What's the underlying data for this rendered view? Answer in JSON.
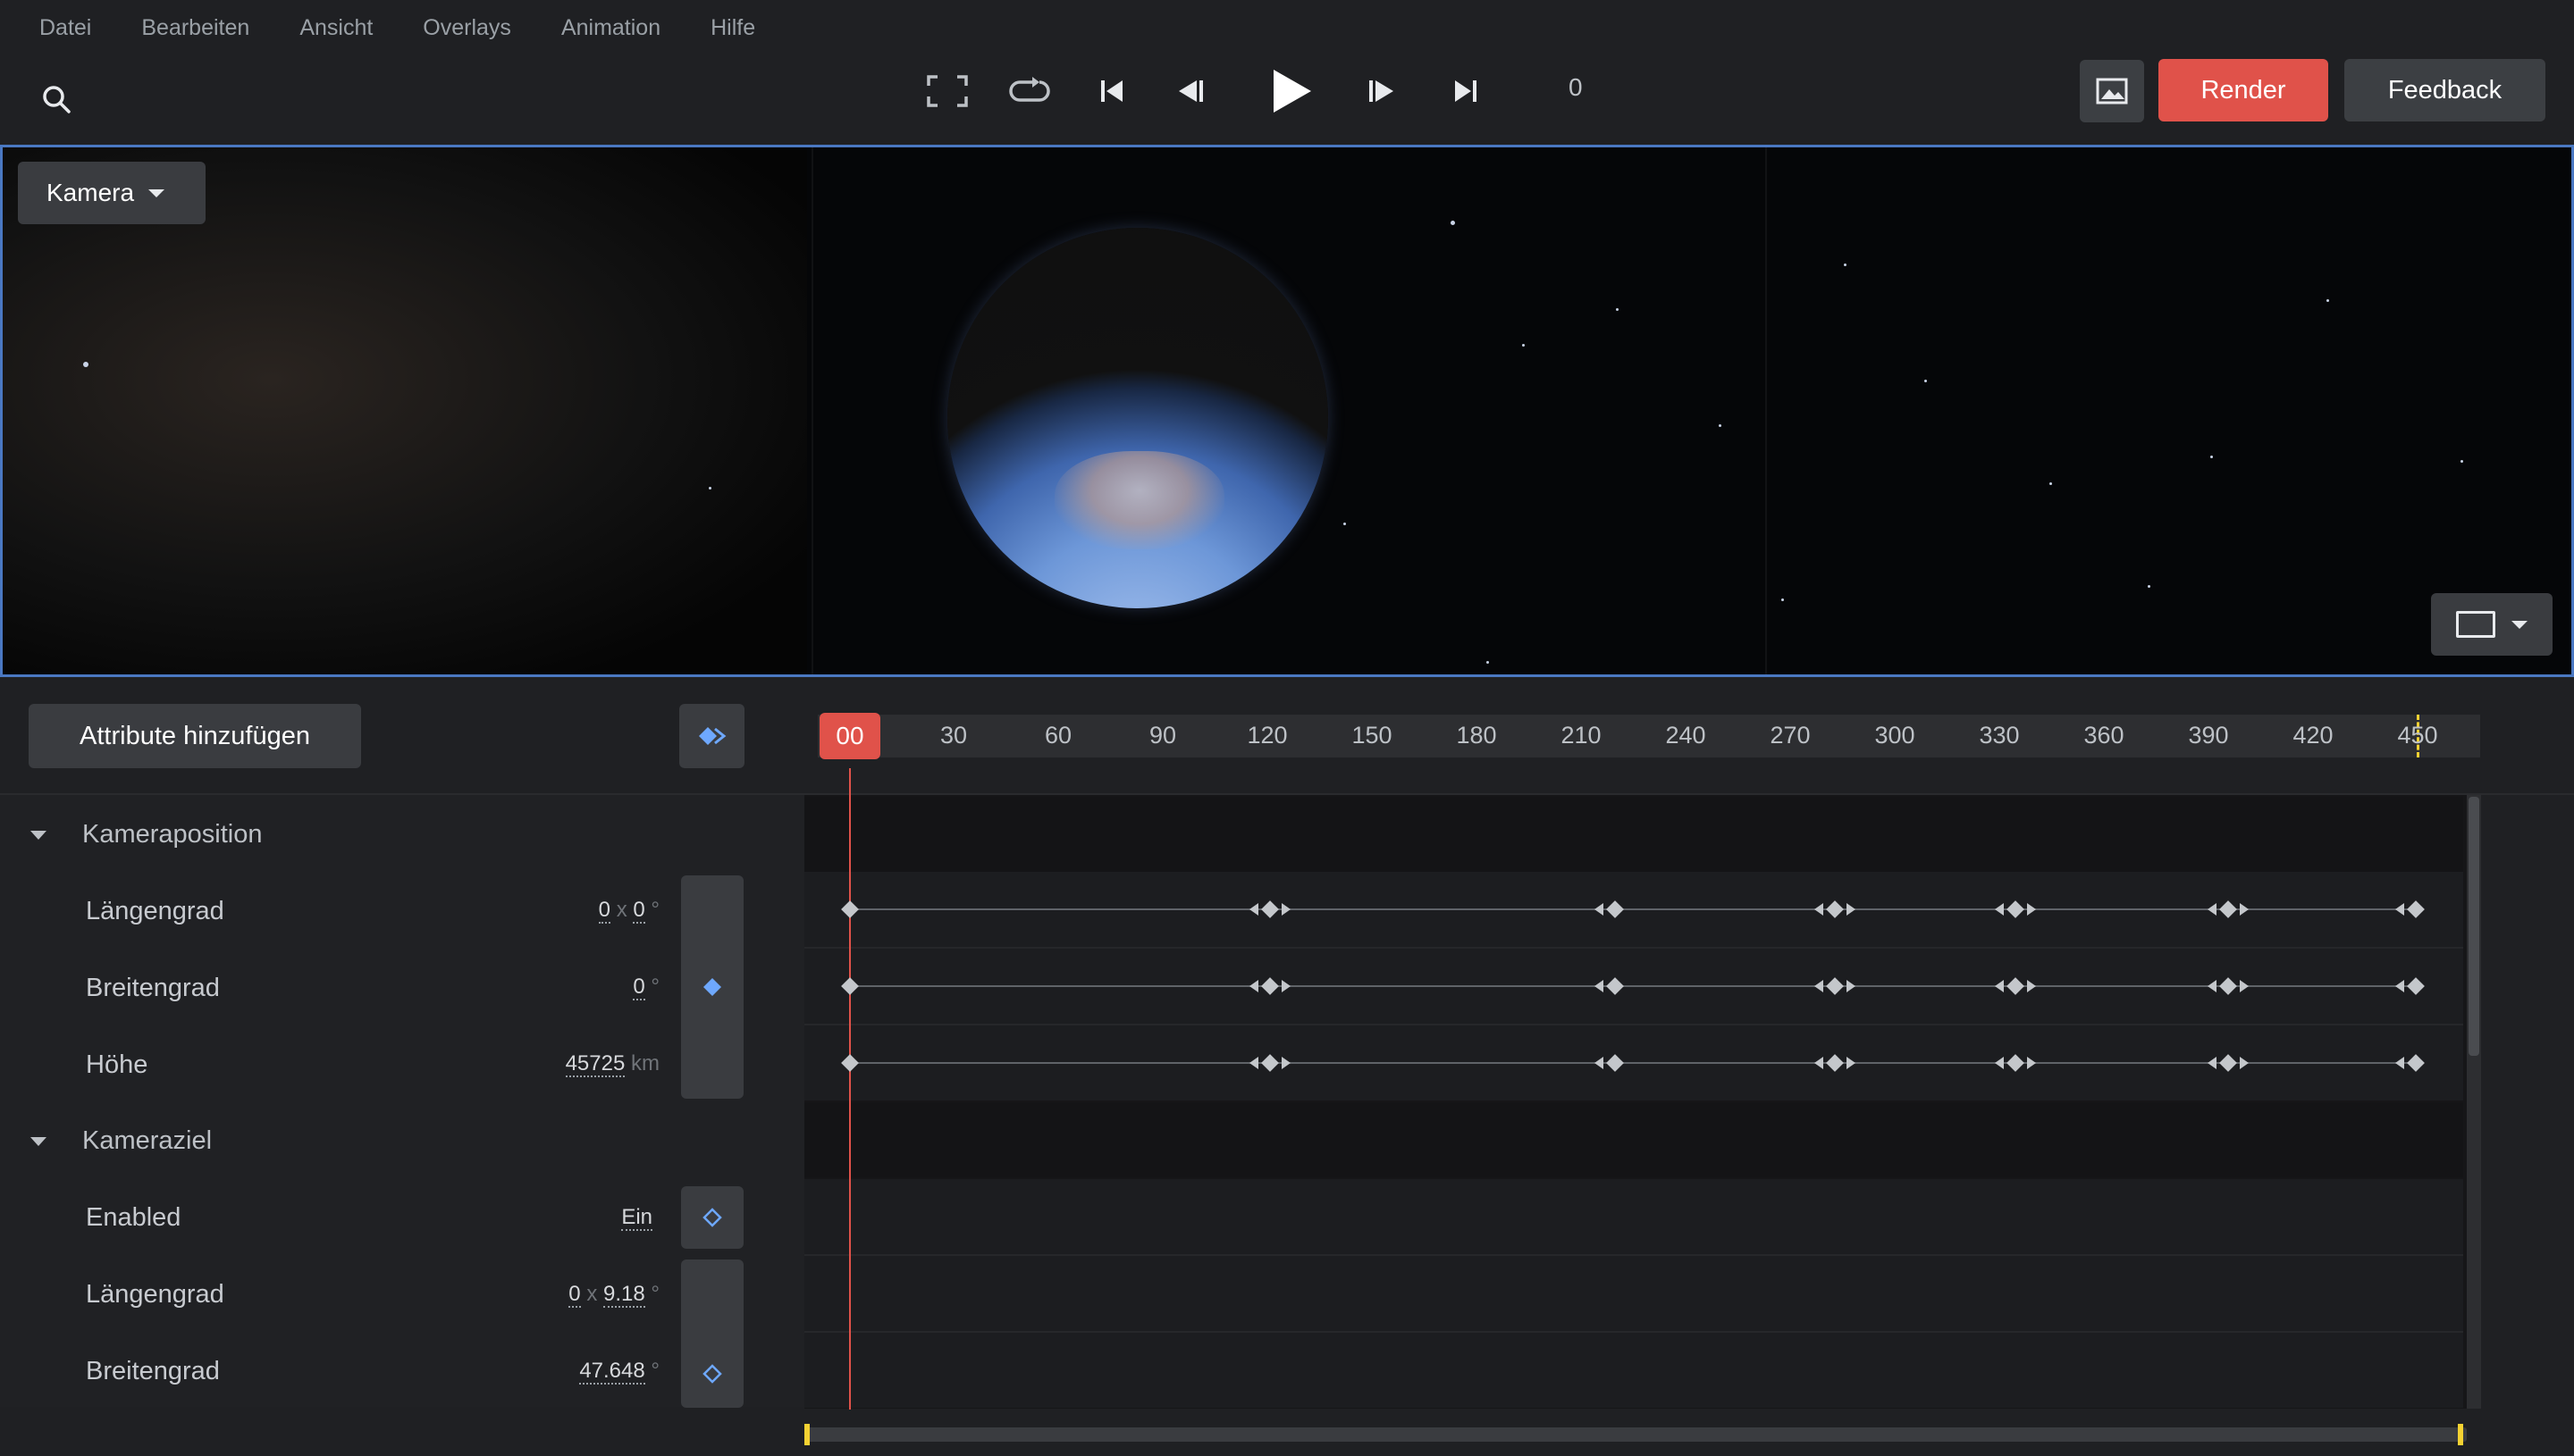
{
  "menu": [
    "Datei",
    "Bearbeiten",
    "Ansicht",
    "Overlays",
    "Animation",
    "Hilfe"
  ],
  "toolbar": {
    "frame_value": "0",
    "render_label": "Render",
    "feedback_label": "Feedback"
  },
  "viewport": {
    "camera_dropdown": "Kamera"
  },
  "timeline": {
    "add_attributes_label": "Attribute hinzufügen",
    "playhead_label": "00",
    "ticks": [
      "30",
      "60",
      "90",
      "120",
      "150",
      "180",
      "210",
      "240",
      "270",
      "300",
      "330",
      "360",
      "390",
      "420",
      "450"
    ],
    "accent_color": "#e0524a",
    "end_marker_color": "#f5d232"
  },
  "attributes": {
    "camera_position": {
      "title": "Kameraposition",
      "longitude": {
        "label": "Längengrad",
        "v1": "0",
        "sep": "x",
        "v2": "0",
        "unit": "°"
      },
      "latitude": {
        "label": "Breitengrad",
        "value": "0",
        "unit": "°"
      },
      "altitude": {
        "label": "Höhe",
        "value": "45725",
        "unit": "km"
      }
    },
    "camera_target": {
      "title": "Kameraziel",
      "enabled": {
        "label": "Enabled",
        "value": "Ein"
      },
      "longitude": {
        "label": "Längengrad",
        "v1": "0",
        "sep": "x",
        "v2": "9.18",
        "unit": "°"
      },
      "latitude": {
        "label": "Breitengrad",
        "value": "47.648",
        "unit": "°"
      }
    }
  },
  "icons": [
    "search-icon",
    "fullscreen-icon",
    "loop-icon",
    "skip-start-icon",
    "step-back-icon",
    "play-icon",
    "step-forward-icon",
    "skip-end-icon",
    "image-icon",
    "keyframe-nav-icon",
    "keyframe-icon"
  ]
}
